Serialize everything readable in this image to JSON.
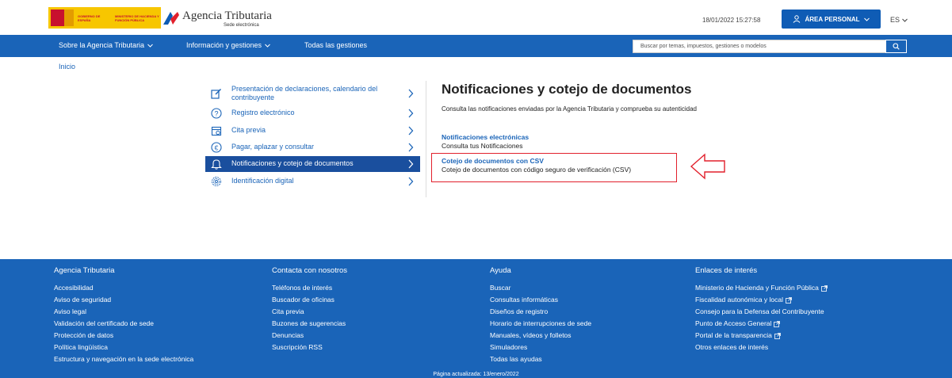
{
  "header": {
    "gov_text1": "GOBIERNO DE ESPAÑA",
    "gov_text2": "MINISTERIO DE HACIENDA Y FUNCIÓN PÚBLICA",
    "agency_title": "Agencia Tributaria",
    "agency_subtitle": "Sede electrónica",
    "date": "18/01/2022 15:27:58",
    "area_personal_label": "ÁREA PERSONAL",
    "lang_label": "ES"
  },
  "navbar": {
    "items": [
      {
        "label": "Sobre la Agencia Tributaria"
      },
      {
        "label": "Información y gestiones"
      },
      {
        "label": "Todas las gestiones"
      }
    ],
    "search_placeholder": "Buscar por temas, impuestos, gestiones o modelos"
  },
  "breadcrumb": {
    "label": "Inicio"
  },
  "menu": {
    "items": [
      {
        "label": "Presentación de declaraciones, calendario del contribuyente",
        "icon": "edit-icon"
      },
      {
        "label": "Registro electrónico",
        "icon": "question-icon"
      },
      {
        "label": "Cita previa",
        "icon": "calendar-icon"
      },
      {
        "label": "Pagar, aplazar y consultar",
        "icon": "euro-icon"
      },
      {
        "label": "Notificaciones y cotejo de documentos",
        "icon": "bell-icon"
      },
      {
        "label": "Identificación digital",
        "icon": "fingerprint-icon"
      }
    ]
  },
  "content": {
    "title": "Notificaciones y cotejo de documentos",
    "description": "Consulta las notificaciones enviadas por la Agencia Tributaria y comprueba su autenticidad",
    "links": [
      {
        "title": "Notificaciones electrónicas",
        "desc": "Consulta tus Notificaciones"
      },
      {
        "title": "Cotejo de documentos con CSV",
        "desc": "Cotejo de documentos con código seguro de verificación (CSV)"
      }
    ]
  },
  "footer": {
    "columns": [
      {
        "heading": "Agencia Tributaria",
        "links": [
          "Accesibilidad",
          "Aviso de seguridad",
          "Aviso legal",
          "Validación del certificado de sede",
          "Protección de datos",
          "Política lingüística",
          "Estructura y navegación en la sede electrónica"
        ]
      },
      {
        "heading": "Contacta con nosotros",
        "links": [
          "Teléfonos de interés",
          "Buscador de oficinas",
          "Cita previa",
          "Buzones de sugerencias",
          "Denuncias",
          "Suscripción RSS"
        ]
      },
      {
        "heading": "Ayuda",
        "links": [
          "Buscar",
          "Consultas informáticas",
          "Diseños de registro",
          "Horario de interrupciones de sede",
          "Manuales, vídeos y folletos",
          "Simuladores",
          "Todas las ayudas"
        ]
      },
      {
        "heading": "Enlaces de interés",
        "links": [
          "Ministerio de Hacienda y Función Pública",
          "Fiscalidad autonómica y local",
          "Consejo para la Defensa del Contribuyente",
          "Punto de Acceso General",
          "Portal de la transparencia",
          "Otros enlaces de interés"
        ]
      }
    ],
    "updated": "Página actualizada: 13/enero/2022"
  },
  "colors": {
    "brand_blue": "#1a64b8",
    "active_blue": "#1a4f9e",
    "annotation_red": "#e2202c"
  }
}
